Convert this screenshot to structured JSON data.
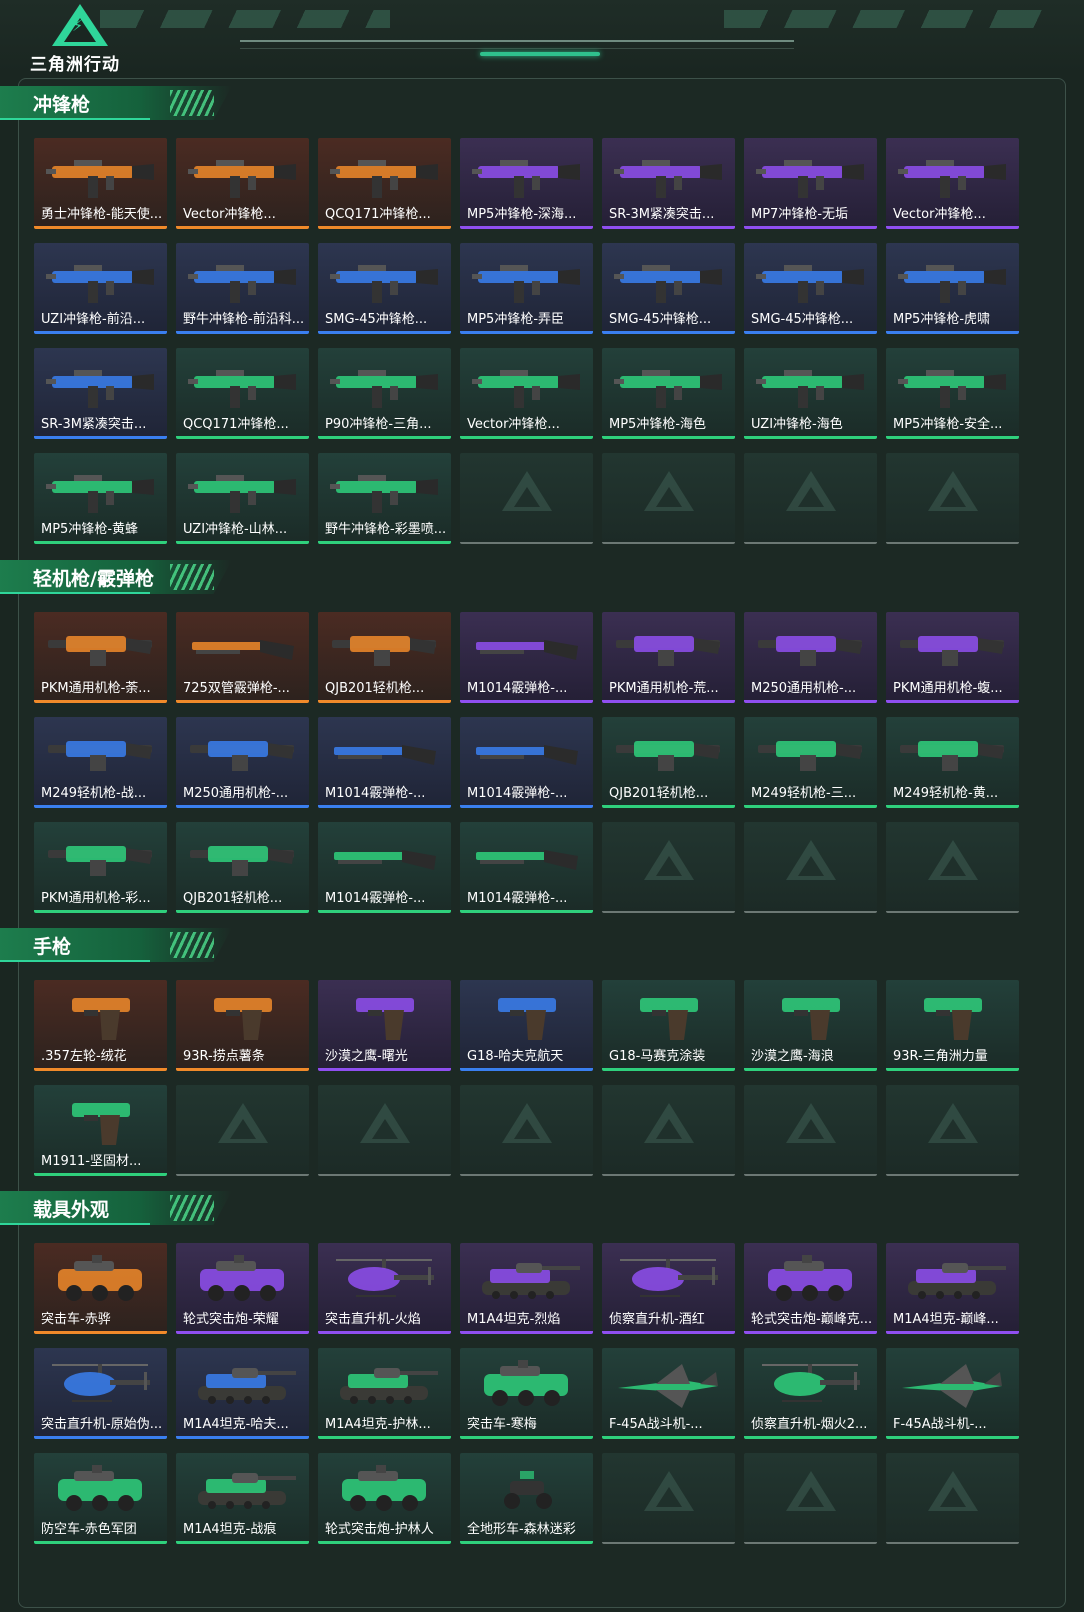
{
  "app": {
    "logo_text": "三角洲行动"
  },
  "sections": [
    {
      "title": "冲锋枪",
      "items": [
        {
          "name": "勇士冲锋枪-能天使...",
          "rarity": "orange",
          "icon": "smg-icon"
        },
        {
          "name": "Vector冲锋枪...",
          "rarity": "orange",
          "icon": "smg-icon"
        },
        {
          "name": "QCQ171冲锋枪...",
          "rarity": "orange",
          "icon": "smg-icon"
        },
        {
          "name": "MP5冲锋枪-深海...",
          "rarity": "purple",
          "icon": "smg-icon"
        },
        {
          "name": "SR-3M紧凑突击...",
          "rarity": "purple",
          "icon": "smg-icon"
        },
        {
          "name": "MP7冲锋枪-无垢",
          "rarity": "purple",
          "icon": "smg-icon"
        },
        {
          "name": "Vector冲锋枪...",
          "rarity": "purple",
          "icon": "smg-icon"
        },
        {
          "name": "UZI冲锋枪-前沿...",
          "rarity": "blue",
          "icon": "smg-icon"
        },
        {
          "name": "野牛冲锋枪-前沿科...",
          "rarity": "blue",
          "icon": "smg-icon"
        },
        {
          "name": "SMG-45冲锋枪...",
          "rarity": "blue",
          "icon": "smg-icon"
        },
        {
          "name": "MP5冲锋枪-弄臣",
          "rarity": "blue",
          "icon": "smg-icon"
        },
        {
          "name": "SMG-45冲锋枪...",
          "rarity": "blue",
          "icon": "smg-icon"
        },
        {
          "name": "SMG-45冲锋枪...",
          "rarity": "blue",
          "icon": "smg-icon"
        },
        {
          "name": "MP5冲锋枪-虎啸",
          "rarity": "blue",
          "icon": "smg-icon"
        },
        {
          "name": "SR-3M紧凑突击...",
          "rarity": "blue",
          "icon": "smg-icon"
        },
        {
          "name": "QCQ171冲锋枪...",
          "rarity": "green",
          "icon": "smg-icon"
        },
        {
          "name": "P90冲锋枪-三角...",
          "rarity": "green",
          "icon": "smg-icon"
        },
        {
          "name": "Vector冲锋枪...",
          "rarity": "green",
          "icon": "smg-icon"
        },
        {
          "name": "MP5冲锋枪-海色",
          "rarity": "green",
          "icon": "smg-icon"
        },
        {
          "name": "UZI冲锋枪-海色",
          "rarity": "green",
          "icon": "smg-icon"
        },
        {
          "name": "MP5冲锋枪-安全...",
          "rarity": "green",
          "icon": "smg-icon"
        },
        {
          "name": "MP5冲锋枪-黄蜂",
          "rarity": "green",
          "icon": "smg-icon"
        },
        {
          "name": "UZI冲锋枪-山林...",
          "rarity": "green",
          "icon": "smg-icon"
        },
        {
          "name": "野牛冲锋枪-彩墨喷...",
          "rarity": "green",
          "icon": "smg-icon"
        }
      ],
      "empty_slots": 4
    },
    {
      "title": "轻机枪/霰弹枪",
      "items": [
        {
          "name": "PKM通用机枪-荼...",
          "rarity": "orange",
          "icon": "lmg-icon"
        },
        {
          "name": "725双管霰弹枪-...",
          "rarity": "orange",
          "icon": "shotgun-icon"
        },
        {
          "name": "QJB201轻机枪...",
          "rarity": "orange",
          "icon": "lmg-icon"
        },
        {
          "name": "M1014霰弹枪-...",
          "rarity": "purple",
          "icon": "shotgun-icon"
        },
        {
          "name": "PKM通用机枪-荒...",
          "rarity": "purple",
          "icon": "lmg-icon"
        },
        {
          "name": "M250通用机枪-...",
          "rarity": "purple",
          "icon": "lmg-icon"
        },
        {
          "name": "PKM通用机枪-蝮...",
          "rarity": "purple",
          "icon": "lmg-icon"
        },
        {
          "name": "M249轻机枪-战...",
          "rarity": "blue",
          "icon": "lmg-icon"
        },
        {
          "name": "M250通用机枪-...",
          "rarity": "blue",
          "icon": "lmg-icon"
        },
        {
          "name": "M1014霰弹枪-...",
          "rarity": "blue",
          "icon": "shotgun-icon"
        },
        {
          "name": "M1014霰弹枪-...",
          "rarity": "blue",
          "icon": "shotgun-icon"
        },
        {
          "name": "QJB201轻机枪...",
          "rarity": "green",
          "icon": "lmg-icon"
        },
        {
          "name": "M249轻机枪-三...",
          "rarity": "green",
          "icon": "lmg-icon"
        },
        {
          "name": "M249轻机枪-黄...",
          "rarity": "green",
          "icon": "lmg-icon"
        },
        {
          "name": "PKM通用机枪-彩...",
          "rarity": "green",
          "icon": "lmg-icon"
        },
        {
          "name": "QJB201轻机枪...",
          "rarity": "green",
          "icon": "lmg-icon"
        },
        {
          "name": "M1014霰弹枪-...",
          "rarity": "green",
          "icon": "shotgun-icon"
        },
        {
          "name": "M1014霰弹枪-...",
          "rarity": "green",
          "icon": "shotgun-icon"
        }
      ],
      "empty_slots": 3
    },
    {
      "title": "手枪",
      "items": [
        {
          "name": ".357左轮-绒花",
          "rarity": "orange",
          "icon": "revolver-icon"
        },
        {
          "name": "93R-捞点薯条",
          "rarity": "orange",
          "icon": "pistol-icon"
        },
        {
          "name": "沙漠之鹰-曙光",
          "rarity": "purple",
          "icon": "pistol-icon"
        },
        {
          "name": "G18-哈夫克航天",
          "rarity": "blue",
          "icon": "pistol-icon"
        },
        {
          "name": "G18-马赛克涂装",
          "rarity": "green",
          "icon": "pistol-icon"
        },
        {
          "name": "沙漠之鹰-海浪",
          "rarity": "green",
          "icon": "pistol-icon"
        },
        {
          "name": "93R-三角洲力量",
          "rarity": "green",
          "icon": "pistol-icon"
        },
        {
          "name": "M1911-坚固材...",
          "rarity": "green",
          "icon": "pistol-icon"
        }
      ],
      "empty_slots": 6
    },
    {
      "title": "载具外观",
      "items": [
        {
          "name": "突击车-赤骅",
          "rarity": "orange",
          "icon": "armored-car-icon"
        },
        {
          "name": "轮式突击炮-荣耀",
          "rarity": "purple",
          "icon": "armored-car-icon"
        },
        {
          "name": "突击直升机-火焰",
          "rarity": "purple",
          "icon": "helicopter-icon"
        },
        {
          "name": "M1A4坦克-烈焰",
          "rarity": "purple",
          "icon": "tank-icon"
        },
        {
          "name": "侦察直升机-酒红",
          "rarity": "purple",
          "icon": "helicopter-icon"
        },
        {
          "name": "轮式突击炮-巅峰克...",
          "rarity": "purple",
          "icon": "armored-car-icon"
        },
        {
          "name": "M1A4坦克-巅峰...",
          "rarity": "purple",
          "icon": "tank-icon"
        },
        {
          "name": "突击直升机-原始伪...",
          "rarity": "blue",
          "icon": "helicopter-icon"
        },
        {
          "name": "M1A4坦克-哈夫...",
          "rarity": "blue",
          "icon": "tank-icon"
        },
        {
          "name": "M1A4坦克-护林...",
          "rarity": "green",
          "icon": "tank-icon"
        },
        {
          "name": "突击车-寒梅",
          "rarity": "green",
          "icon": "armored-car-icon"
        },
        {
          "name": "F-45A战斗机-...",
          "rarity": "green",
          "icon": "jet-icon"
        },
        {
          "name": "侦察直升机-烟火2...",
          "rarity": "green",
          "icon": "helicopter-icon"
        },
        {
          "name": "F-45A战斗机-...",
          "rarity": "green",
          "icon": "jet-icon"
        },
        {
          "name": "防空车-赤色军团",
          "rarity": "green",
          "icon": "armored-car-icon"
        },
        {
          "name": "M1A4坦克-战痕",
          "rarity": "green",
          "icon": "tank-icon"
        },
        {
          "name": "轮式突击炮-护林人",
          "rarity": "green",
          "icon": "armored-car-icon"
        },
        {
          "name": "全地形车-森林迷彩",
          "rarity": "green",
          "icon": "atv-icon"
        }
      ],
      "empty_slots": 3
    }
  ],
  "colors": {
    "orange": "#f08a2a",
    "purple": "#8f4ff0",
    "blue": "#3a7ff0",
    "green": "#2fd07c",
    "accent": "#2fd69a"
  }
}
